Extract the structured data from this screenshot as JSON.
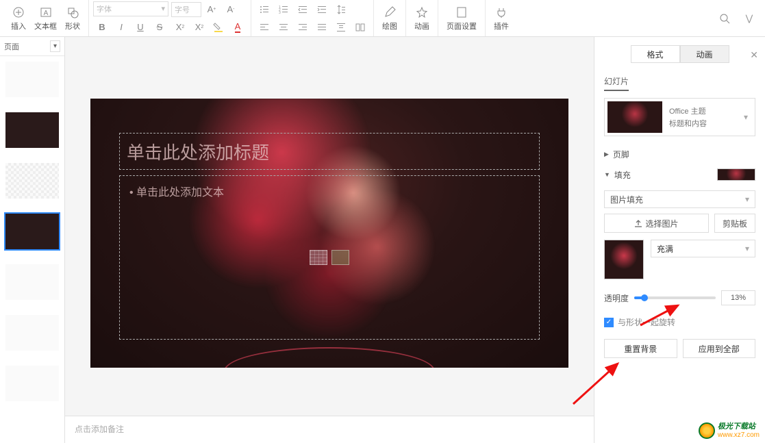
{
  "toolbar": {
    "insert": "插入",
    "textbox": "文本框",
    "shape": "形状",
    "font_placeholder": "字体",
    "size_placeholder": "字号",
    "draw": "绘图",
    "animation": "动画",
    "page_setup": "页面设置",
    "plugin": "插件"
  },
  "left": {
    "page_label": "页面"
  },
  "slide": {
    "title_placeholder": "单击此处添加标题",
    "content_placeholder": "• 单击此处添加文本"
  },
  "notes": {
    "placeholder": "点击添加备注"
  },
  "right": {
    "tab_format": "格式",
    "tab_anim": "动画",
    "section_slide": "幻灯片",
    "theme_name": "Office 主题",
    "theme_layout": "标题和内容",
    "footer": "页脚",
    "fill": "填充",
    "fill_type": "图片填充",
    "choose_image": "选择图片",
    "clipboard": "剪贴板",
    "fill_mode": "充满",
    "opacity_label": "透明度",
    "opacity_value": "13%",
    "rotate_with_shape": "与形状一起旋转",
    "reset_bg": "重置背景",
    "apply_all": "应用到全部"
  },
  "watermark": {
    "cn": "极光下载站",
    "url": "www.xz7.com"
  }
}
